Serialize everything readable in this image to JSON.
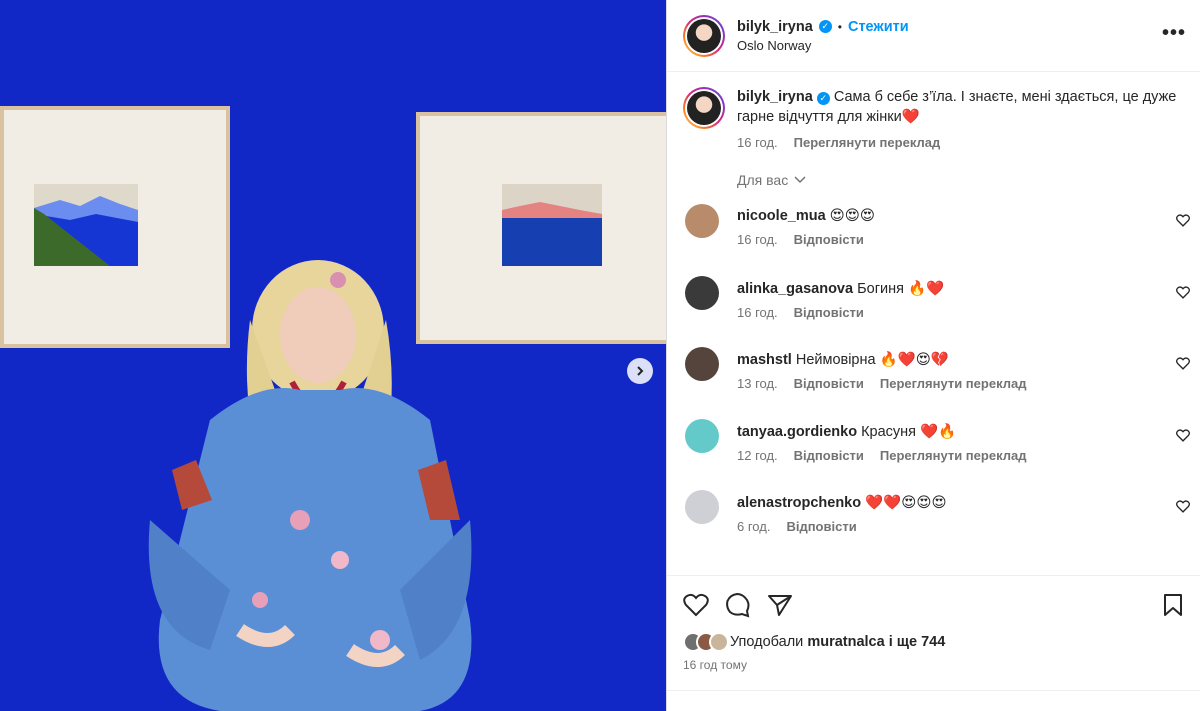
{
  "post": {
    "username": "bilyk_iryna",
    "follow_label": "Стежити",
    "location": "Oslo Norway",
    "caption": "Сама б себе з’їла. І знаєте, мені здається, це дуже гарне відчуття для жінки❤️",
    "caption_time": "16 год.",
    "see_translation": "Переглянути переклад",
    "for_you_label": "Для вас",
    "likes_prefix": "Уподобали",
    "likes_user": "muratnalca",
    "likes_suffix": "і ще 744",
    "posted_ago": "16 год тому"
  },
  "comments": [
    {
      "user": "nicoole_mua",
      "text": "😍😍😍",
      "time": "16 год.",
      "reply": "Відповісти",
      "translate": "",
      "avatar_color": "#b88c6a"
    },
    {
      "user": "alinka_gasanova",
      "text": "Богиня 🔥❤️",
      "time": "16 год.",
      "reply": "Відповісти",
      "translate": "",
      "avatar_color": "#3a3a3a"
    },
    {
      "user": "mashstl",
      "text": "Неймовірна 🔥❤️😍💔",
      "time": "13 год.",
      "reply": "Відповісти",
      "translate": "Переглянути переклад",
      "avatar_color": "#55443c"
    },
    {
      "user": "tanyaa.gordienko",
      "text": "Красуня ❤️🔥",
      "time": "12 год.",
      "reply": "Відповісти",
      "translate": "Переглянути переклад",
      "avatar_color": "#63c9c9"
    },
    {
      "user": "alenastropchenko",
      "text": "❤️❤️😍😍😍",
      "time": "6 год.",
      "reply": "Відповісти",
      "translate": "",
      "avatar_color": "#cfcfd6"
    }
  ],
  "colors": {
    "accent": "#0095f6",
    "muted": "#737373",
    "photo_bg": "#1228c6"
  },
  "icons": [
    "like-icon",
    "comment-icon",
    "share-icon",
    "save-icon",
    "more-icon",
    "next-arrow-icon",
    "verified-icon"
  ]
}
